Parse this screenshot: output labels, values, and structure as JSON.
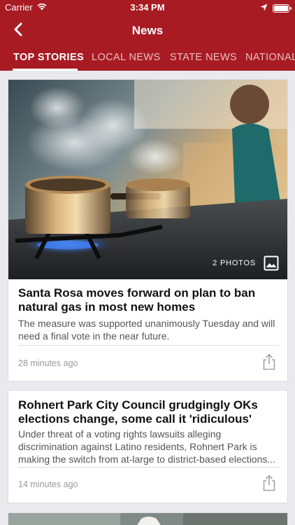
{
  "status_bar": {
    "carrier": "Carrier",
    "time": "3:34 PM"
  },
  "nav": {
    "title": "News",
    "back_icon": "chevron-left-icon"
  },
  "tabs": [
    {
      "label": "TOP STORIES",
      "active": true
    },
    {
      "label": "LOCAL NEWS",
      "active": false
    },
    {
      "label": "STATE NEWS",
      "active": false
    },
    {
      "label": "NATIONAL",
      "active": false
    }
  ],
  "stories": [
    {
      "photo_count": "2 PHOTOS",
      "headline": "Santa Rosa moves forward on plan to ban natural gas in most new homes",
      "summary": "The measure was supported unanimously Tuesday and will need a final vote in the near future.",
      "time_ago": "28 minutes ago"
    },
    {
      "headline": "Rohnert Park City Council grudgingly OKs elections change, some call it 'ridiculous'",
      "summary_lines": [
        "Under threat of a voting rights lawsuits alleging",
        "discrimination against Latino residents, Rohnert Park is",
        "making the switch from at-large to district-based elections..."
      ],
      "time_ago": "14 minutes ago"
    }
  ],
  "colors": {
    "brand": "#a81b23",
    "background": "#e9e9ee",
    "card": "#ffffff"
  }
}
